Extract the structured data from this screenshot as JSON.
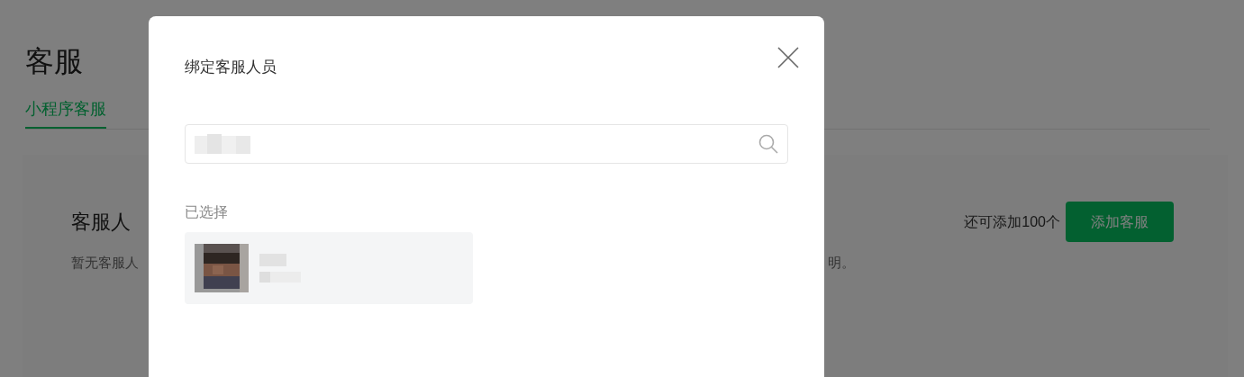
{
  "page": {
    "title": "客服",
    "tabs": [
      {
        "label": "小程序客服",
        "selected": true
      }
    ],
    "card": {
      "heading": "客服人",
      "note_start": "暂无客服人",
      "note_end": "明。",
      "remaining": "还可添加100个",
      "add_button": "添加客服"
    }
  },
  "dialog": {
    "title": "绑定客服人员",
    "selected_label": "已选择"
  }
}
